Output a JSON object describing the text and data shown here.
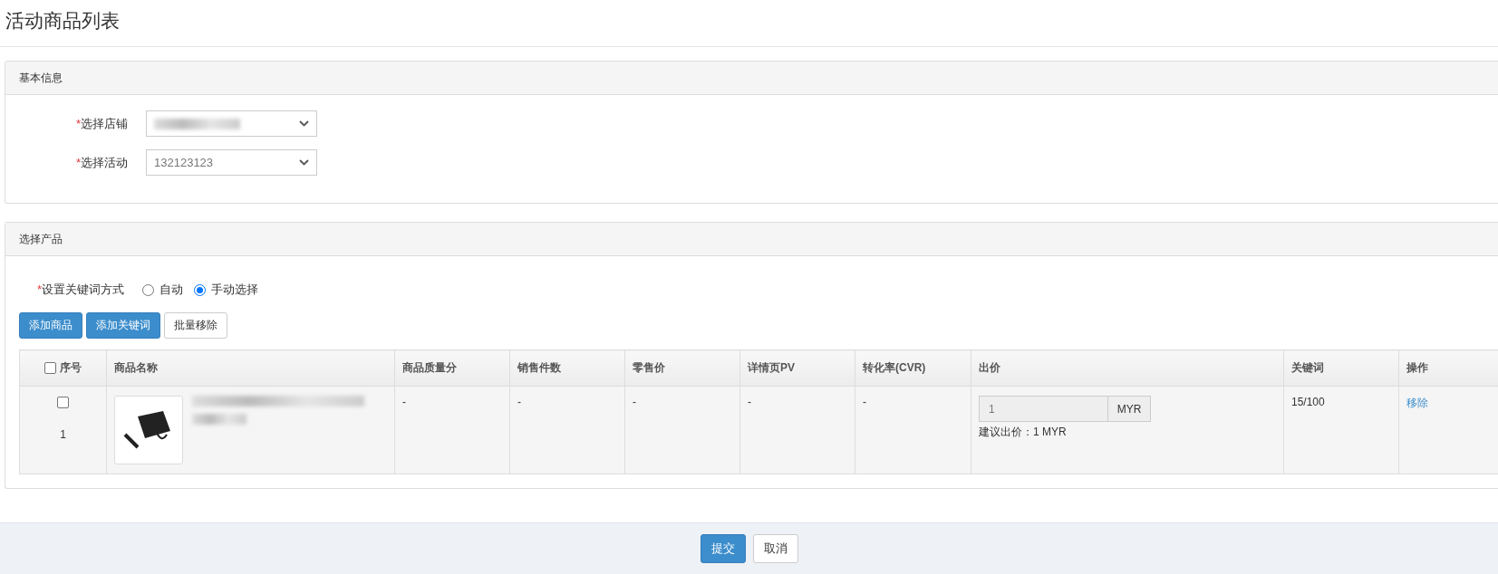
{
  "page_title": "活动商品列表",
  "basic_info": {
    "title": "基本信息",
    "fields": [
      {
        "label": "选择店铺",
        "required_mark": "*",
        "value_redacted": true
      },
      {
        "label": "选择活动",
        "required_mark": "*",
        "value": "132123123"
      }
    ]
  },
  "product_section": {
    "title": "选择产品",
    "keyword_mode": {
      "label": "设置关键词方式",
      "required_mark": "*",
      "options": [
        {
          "label": "自动",
          "selected": false
        },
        {
          "label": "手动选择",
          "selected": true
        }
      ]
    },
    "buttons": [
      {
        "label": "添加商品",
        "kind": "primary"
      },
      {
        "label": "添加关键词",
        "kind": "primary"
      },
      {
        "label": "批量移除",
        "kind": "default"
      }
    ],
    "table": {
      "select_all_checked": false,
      "columns": [
        "序号",
        "商品名称",
        "商品质量分",
        "销售件数",
        "零售价",
        "详情页PV",
        "转化率(CVR)",
        "出价",
        "关键词",
        "操作"
      ],
      "rows": [
        {
          "checked": false,
          "index": "1",
          "quality": "-",
          "sales": "-",
          "retail_price": "-",
          "pv": "-",
          "cvr": "-",
          "bid_value": "1",
          "bid_unit": "MYR",
          "bid_hint": "建议出价：1 MYR",
          "keywords": "15/100",
          "action": "移除"
        }
      ]
    }
  },
  "footer": {
    "buttons": [
      {
        "label": "提交",
        "kind": "primary"
      },
      {
        "label": "取消",
        "kind": "default"
      }
    ]
  }
}
